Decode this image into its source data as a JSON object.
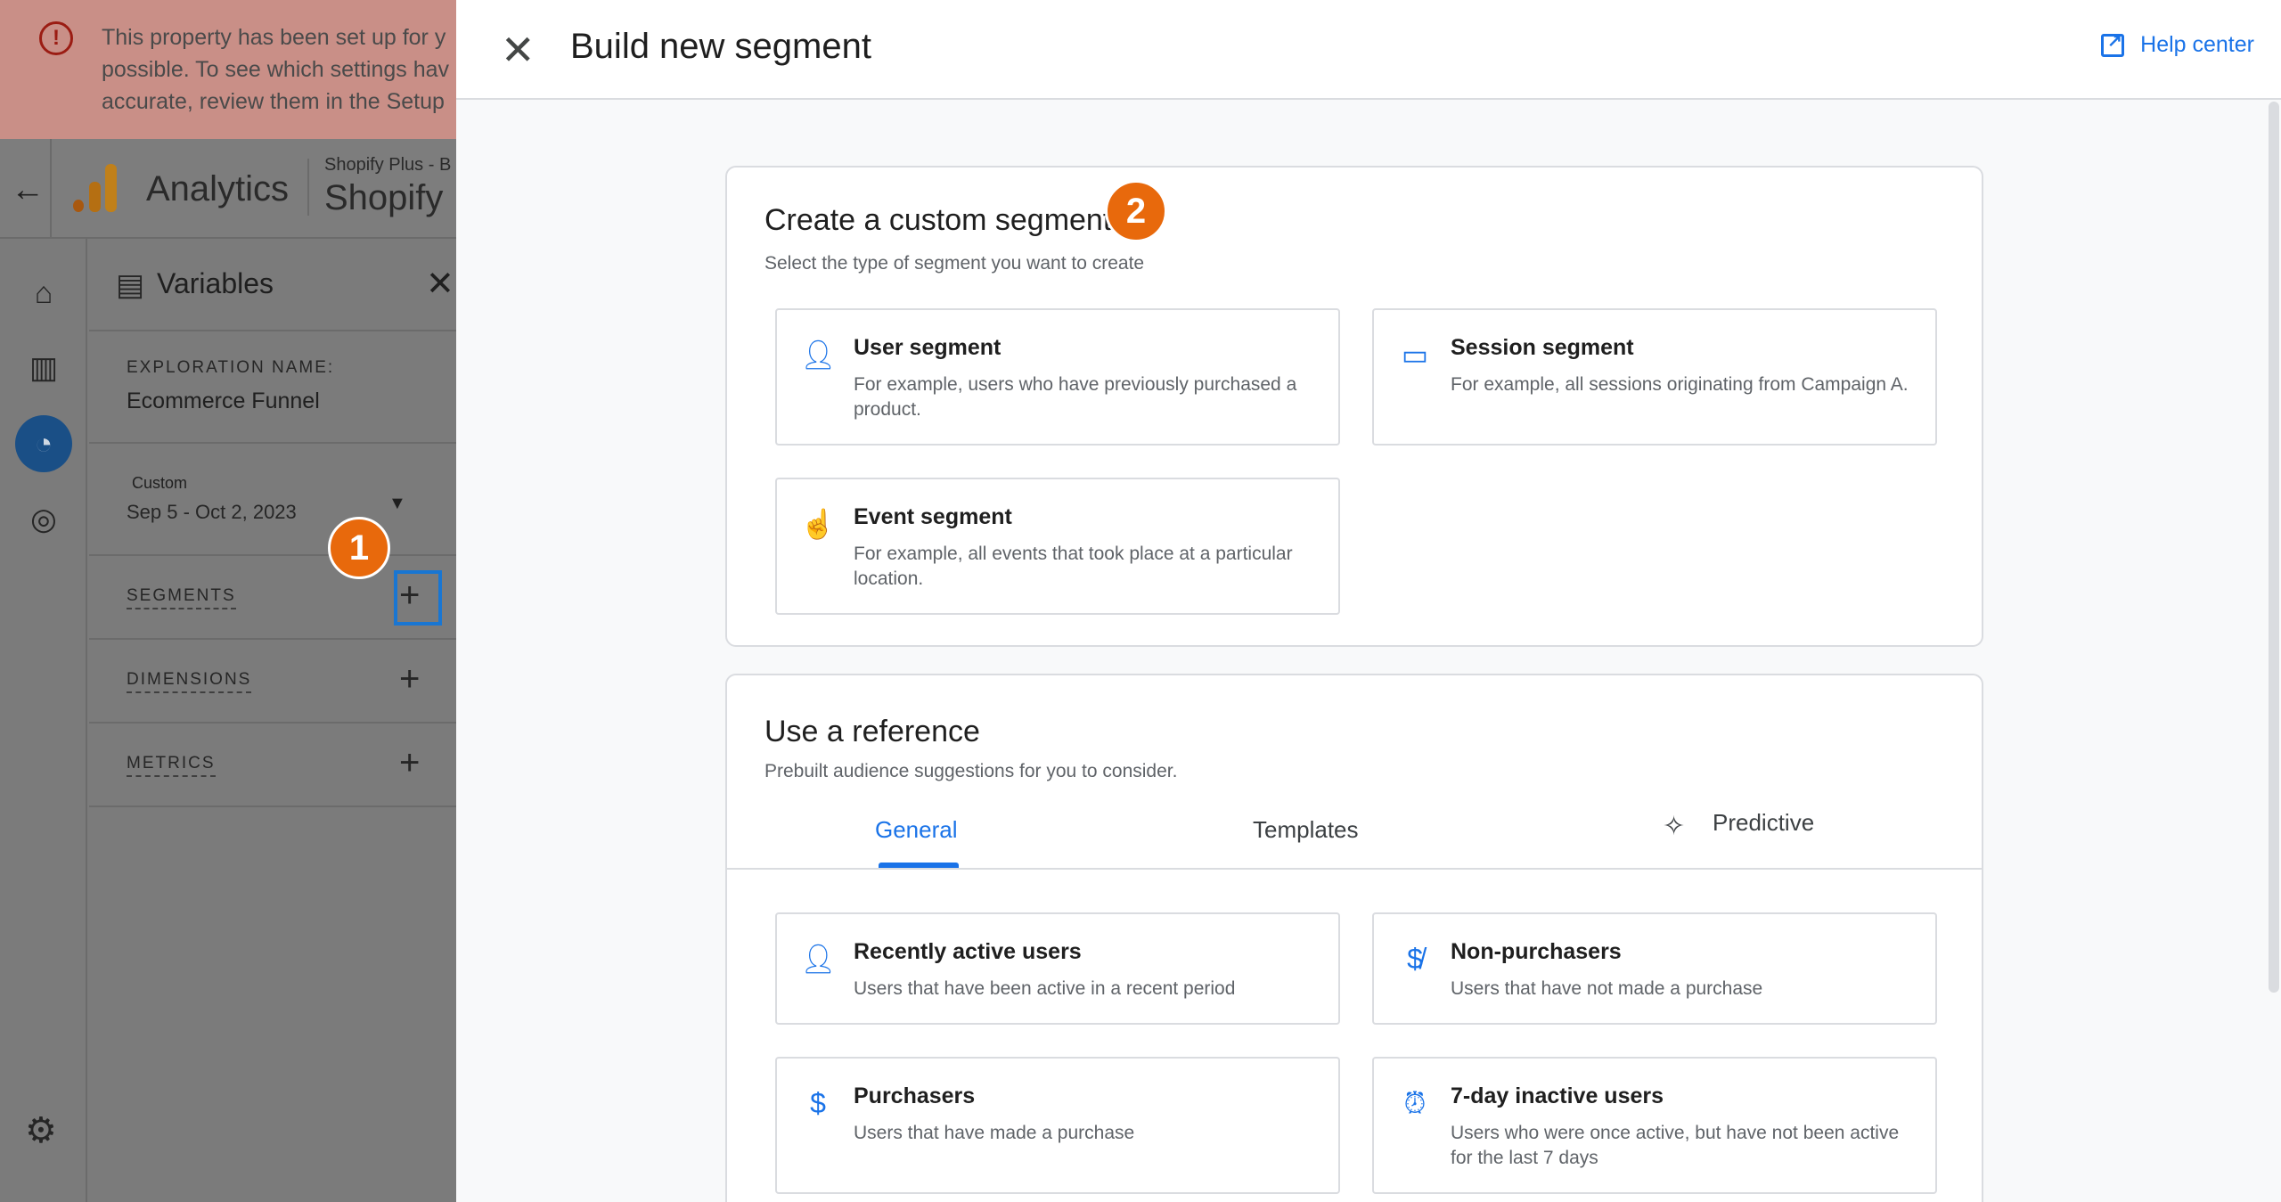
{
  "background": {
    "alert": {
      "text": "This property has been set up for y\npossible. To see which settings hav\naccurate, review them in the Setup"
    },
    "app": {
      "name": "Analytics",
      "account_small": "Shopify Plus - B",
      "account_big": "Shopify I"
    },
    "variables_panel": {
      "title": "Variables",
      "exploration_label": "EXPLORATION NAME:",
      "exploration_name": "Ecommerce Funnel",
      "date_label": "Custom",
      "date_value": "Sep 5 - Oct 2, 2023",
      "segments_label": "SEGMENTS",
      "dimensions_label": "DIMENSIONS",
      "metrics_label": "METRICS"
    },
    "step_badges": [
      "1",
      "2"
    ]
  },
  "modal": {
    "title": "Build new segment",
    "help_label": "Help center",
    "custom_card": {
      "title": "Create a custom segment",
      "subtitle": "Select the type of segment you want to create",
      "tiles": [
        {
          "icon": "person-icon",
          "name": "User segment",
          "desc": "For example, users who have previously purchased a product."
        },
        {
          "icon": "session-icon",
          "name": "Session segment",
          "desc": "For example, all sessions originating from Campaign A."
        },
        {
          "icon": "touch-icon",
          "name": "Event segment",
          "desc": "For example, all events that took place at a particular location."
        }
      ]
    },
    "reference_card": {
      "title": "Use a reference",
      "subtitle": "Prebuilt audience suggestions for you to consider.",
      "tabs": [
        "General",
        "Templates",
        "Predictive"
      ],
      "active_tab": "General",
      "tiles": [
        {
          "icon": "person-icon",
          "name": "Recently active users",
          "desc": "Users that have been active in a recent period"
        },
        {
          "icon": "no-money-icon",
          "name": "Non-purchasers",
          "desc": "Users that have not made a purchase"
        },
        {
          "icon": "dollar-icon",
          "name": "Purchasers",
          "desc": "Users that have made a purchase"
        },
        {
          "icon": "alarm-off-icon",
          "name": "7-day inactive users",
          "desc": "Users who were once active, but have not been active for the last 7 days"
        }
      ]
    }
  },
  "colors": {
    "accent": "#1a73e8",
    "badge": "#e8690c"
  }
}
